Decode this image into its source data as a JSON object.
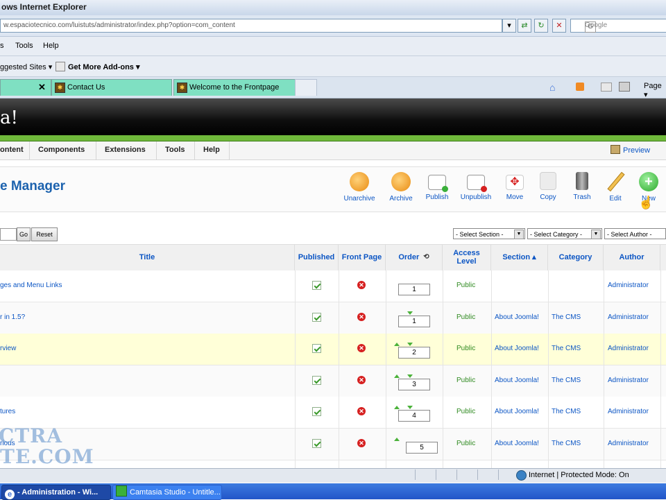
{
  "window": {
    "title": "ows Internet Explorer"
  },
  "address": {
    "url": "w.espaciotecnico.com/luistuts/administrator/index.php?option=com_content"
  },
  "search": {
    "placeholder": "Google"
  },
  "menu": {
    "items": [
      "s",
      "Tools",
      "Help"
    ]
  },
  "favorites": {
    "suggested": "ggested Sites ▾",
    "addons": "Get More Add-ons ▾"
  },
  "tabs": [
    {
      "label": ""
    },
    {
      "label": "Contact Us"
    },
    {
      "label": "Welcome to the Frontpage"
    }
  ],
  "ie_toolbar": {
    "page": "Page ▾"
  },
  "joomla": {
    "logo": "a!",
    "menu": [
      "ontent",
      "Components",
      "Extensions",
      "Tools",
      "Help"
    ],
    "preview": "Preview",
    "page_title": "e Manager",
    "toolbar": [
      {
        "label": "Unarchive",
        "icon": "unarchive-icon",
        "color": "#f0a020"
      },
      {
        "label": "Archive",
        "icon": "archive-icon",
        "color": "#f0a020"
      },
      {
        "label": "Publish",
        "icon": "publish-icon",
        "color": "#ffffff"
      },
      {
        "label": "Unpublish",
        "icon": "unpublish-icon",
        "color": "#ffffff"
      },
      {
        "label": "Move",
        "icon": "move-icon",
        "color": "#e04040"
      },
      {
        "label": "Copy",
        "icon": "copy-icon",
        "color": "#e0e0e0"
      },
      {
        "label": "Trash",
        "icon": "trash-icon",
        "color": "#666666"
      },
      {
        "label": "Edit",
        "icon": "edit-icon",
        "color": "#f2c050"
      },
      {
        "label": "New",
        "icon": "new-icon",
        "color": "#3ec43e"
      }
    ],
    "filter": {
      "go": "Go",
      "reset": "Reset",
      "section": "- Select Section -",
      "category": "- Select Category -",
      "author": "- Select Author -"
    },
    "columns": {
      "title": "Title",
      "published": "Published",
      "frontpage": "Front Page",
      "order": "Order",
      "access": "Access Level",
      "section": "Section ▴",
      "category": "Category",
      "author": "Author"
    },
    "rows": [
      {
        "title": "ges and Menu Links",
        "order": "1",
        "access": "Public",
        "section": "",
        "category": "",
        "author": "Administrator",
        "up": false,
        "down": false
      },
      {
        "title": "r in 1.5?",
        "order": "1",
        "access": "Public",
        "section": "About Joomla!",
        "category": "The CMS",
        "author": "Administrator",
        "up": false,
        "down": true
      },
      {
        "title": "rview",
        "order": "2",
        "access": "Public",
        "section": "About Joomla!",
        "category": "The CMS",
        "author": "Administrator",
        "up": true,
        "down": true
      },
      {
        "title": "",
        "order": "3",
        "access": "Public",
        "section": "About Joomla!",
        "category": "The CMS",
        "author": "Administrator",
        "up": true,
        "down": true
      },
      {
        "title": "tures",
        "order": "4",
        "access": "Public",
        "section": "About Joomla!",
        "category": "The CMS",
        "author": "Administrator",
        "up": true,
        "down": true
      },
      {
        "title": "rious",
        "order": "5",
        "access": "Public",
        "section": "About Joomla!",
        "category": "The CMS",
        "author": "Administrator",
        "up": true,
        "down": false
      }
    ]
  },
  "watermark": {
    "line1": "CTRA",
    "line2": "TE.COM"
  },
  "statusbar": {
    "text": "Internet | Protected Mode: On"
  },
  "taskbar": [
    {
      "label": "- Administration - Wi..."
    },
    {
      "label": "Camtasia Studio - Untitle..."
    }
  ]
}
